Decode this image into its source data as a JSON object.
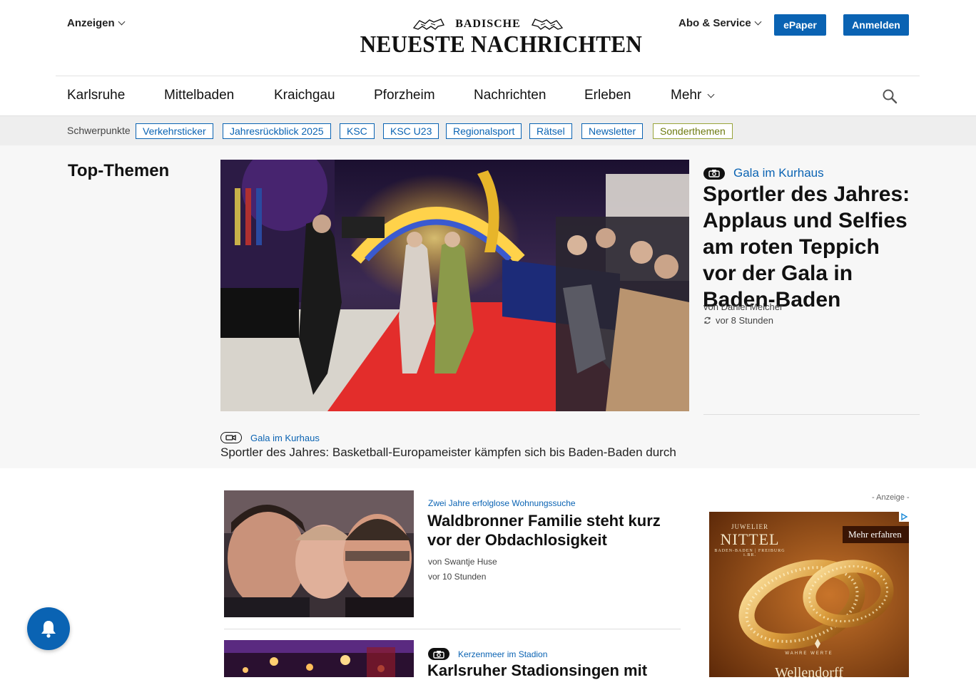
{
  "header": {
    "ads_menu": "Anzeigen",
    "logo_top": "BADISCHE",
    "logo_main": "NEUESTE NACHRICHTEN",
    "abo_menu": "Abo & Service",
    "epaper": "ePaper",
    "login": "Anmelden"
  },
  "nav": {
    "items": [
      "Karlsruhe",
      "Mittelbaden",
      "Kraichgau",
      "Pforzheim",
      "Nachrichten",
      "Erleben"
    ],
    "more": "Mehr"
  },
  "topics": {
    "label": "Schwerpunkte",
    "pills": [
      "Verkehrsticker",
      "Jahresrückblick 2025",
      "KSC",
      "KSC U23",
      "Regionalsport",
      "Rätsel",
      "Newsletter",
      "Sonderthemen"
    ]
  },
  "top": {
    "heading": "Top-Themen",
    "hero": {
      "kicker": "Gala im Kurhaus",
      "title": "Sportler des Jahres: Applaus und Selfies am roten Teppich vor der Gala in Baden-Baden",
      "author": "von Daniel Melcher",
      "time": "vor 8 Stunden"
    },
    "second": {
      "kicker": "Gala im Kurhaus",
      "title": "Sportler des Jahres: Basketball-Europameister kämpfen sich bis Baden-Baden durch"
    }
  },
  "articles": [
    {
      "kicker": "Zwei Jahre erfolglose Wohnungssuche",
      "title": "Waldbronner Familie steht kurz vor der Obdachlosigkeit",
      "author": "von Swantje Huse",
      "time": "vor 10 Stunden"
    },
    {
      "kicker": "Kerzenmeer im Stadion",
      "title": "Karlsruher Stadionsingen mit"
    }
  ],
  "ad": {
    "label": "- Anzeige -",
    "brand_small": "JUWELIER",
    "brand_big": "NITTEL",
    "brand_sub": "BADEN-BADEN | FREIBURG i.BR.",
    "cta": "Mehr erfahren",
    "tagline": "WAHRE WERTE",
    "bottom": "Wellendorff"
  },
  "icons": {
    "notification": "bell-icon",
    "search": "search-icon",
    "photo": "camera-icon",
    "video": "video-icon",
    "updated": "refresh-icon"
  },
  "colors": {
    "brand_blue": "#0a63b3",
    "special_pill": "#98a43a"
  }
}
